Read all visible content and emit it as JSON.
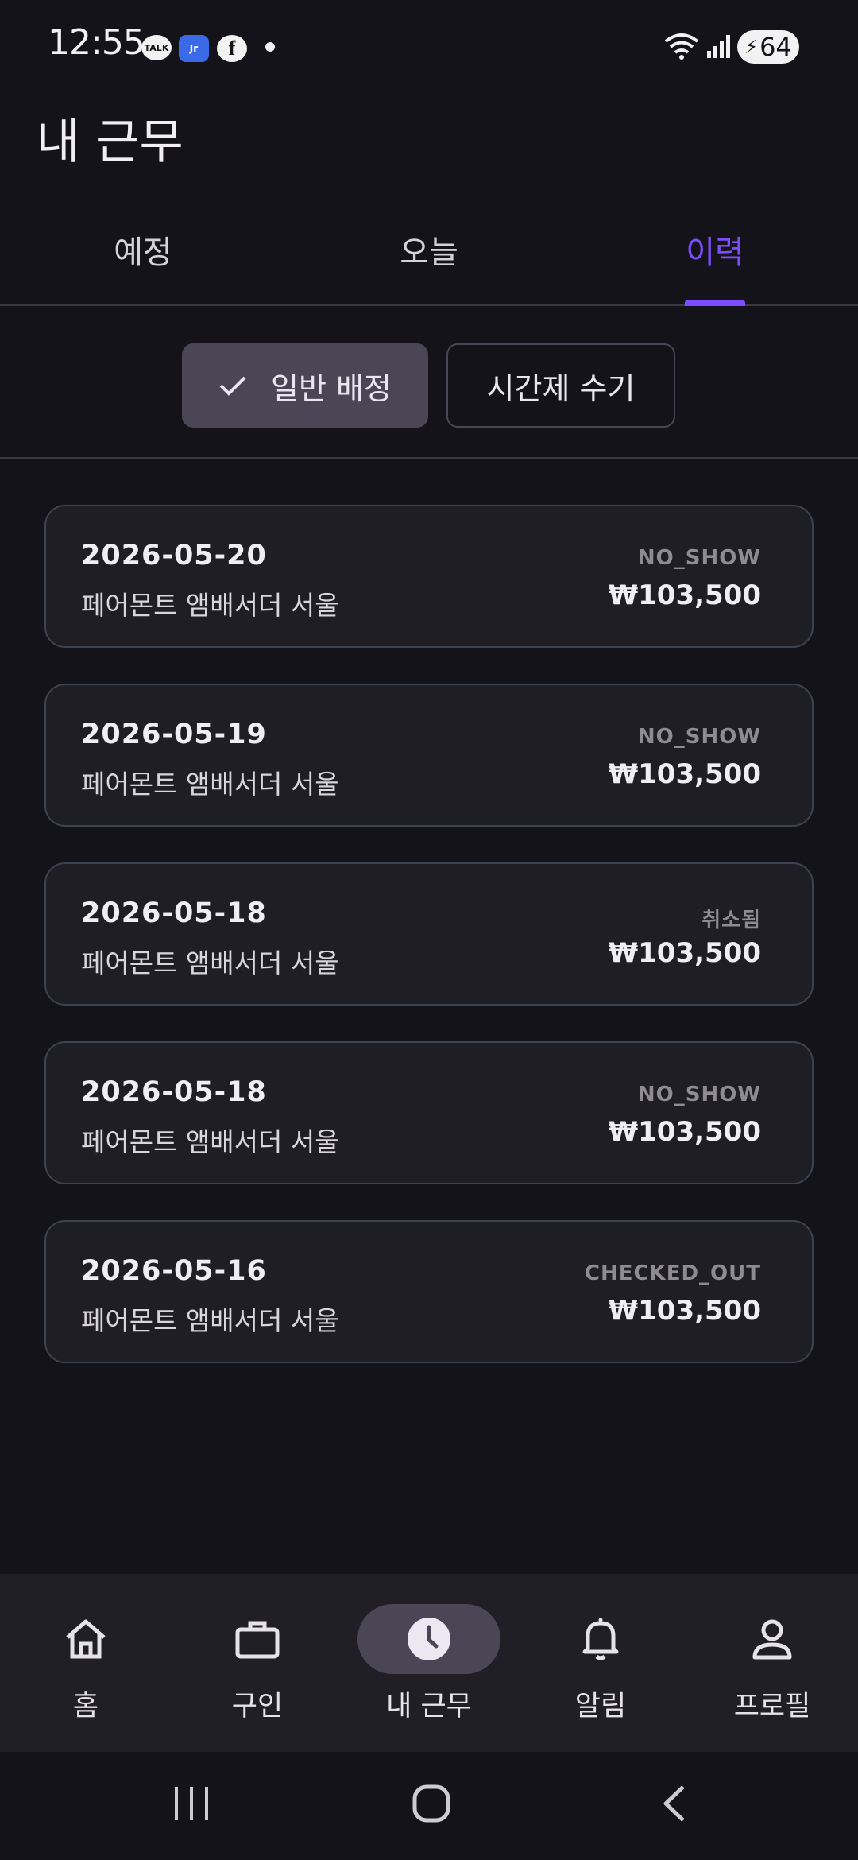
{
  "status_bar": {
    "time": "12:55",
    "talk_label": "TALK",
    "app_label": "Jr",
    "fb_label": "f",
    "battery": "64"
  },
  "header": {
    "title": "내 근무"
  },
  "tabs": [
    {
      "label": "예정",
      "active": false
    },
    {
      "label": "오늘",
      "active": false
    },
    {
      "label": "이력",
      "active": true
    }
  ],
  "segments": {
    "selected_label": "일반 배정",
    "other_label": "시간제 수기"
  },
  "cards": [
    {
      "date": "2026-05-20",
      "venue": "페어몬트 앰배서더 서울",
      "status": "NO_SHOW",
      "amount": "₩103,500"
    },
    {
      "date": "2026-05-19",
      "venue": "페어몬트 앰배서더 서울",
      "status": "NO_SHOW",
      "amount": "₩103,500"
    },
    {
      "date": "2026-05-18",
      "venue": "페어몬트 앰배서더 서울",
      "status": "취소됨",
      "amount": "₩103,500"
    },
    {
      "date": "2026-05-18",
      "venue": "페어몬트 앰배서더 서울",
      "status": "NO_SHOW",
      "amount": "₩103,500"
    },
    {
      "date": "2026-05-16",
      "venue": "페어몬트 앰배서더 서울",
      "status": "CHECKED_OUT",
      "amount": "₩103,500"
    }
  ],
  "bottom_nav": [
    {
      "label": "홈",
      "icon": "home-icon",
      "active": false
    },
    {
      "label": "구인",
      "icon": "briefcase-icon",
      "active": false
    },
    {
      "label": "내 근무",
      "icon": "clock-icon",
      "active": true
    },
    {
      "label": "알림",
      "icon": "bell-icon",
      "active": false
    },
    {
      "label": "프로필",
      "icon": "person-icon",
      "active": false
    }
  ],
  "colors": {
    "accent": "#7c4dff",
    "background": "#15131a",
    "card": "#1f1e24",
    "card_border": "#3d4250",
    "selected_chip": "#4a4656"
  }
}
